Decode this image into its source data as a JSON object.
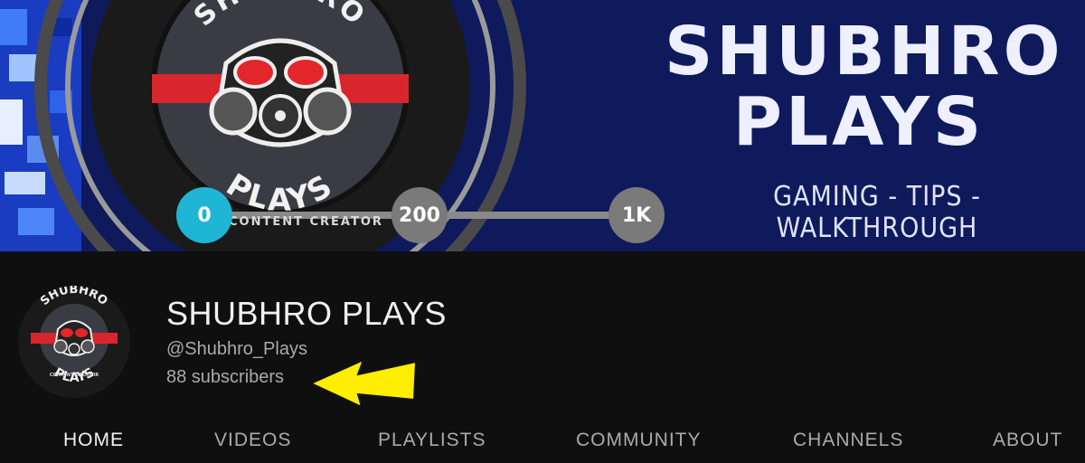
{
  "banner": {
    "logo_top_text": "SHUBHRO",
    "logo_bottom_text": "PLAYS",
    "creator_caption": "CONTENT CREATOR",
    "title_line1": "SHUBHRO",
    "title_line2": "PLAYS",
    "tagline": "GAMING - TIPS - WALKTHROUGH",
    "milestones": [
      "0",
      "200",
      "1K"
    ],
    "progress_fraction": 0.0,
    "colors": {
      "background": "#0f1a5c",
      "milestone_active": "#1fb5d4",
      "mask_red": "#d8262c"
    }
  },
  "channel": {
    "name": "SHUBHRO PLAYS",
    "handle": "@Shubhro_Plays",
    "subscribers": "88 subscribers",
    "avatar_top_text": "SHUBHRO",
    "avatar_bottom_text": "PLAYS",
    "avatar_caption": "CONTENT CREATOR"
  },
  "annotation": {
    "icon": "arrow-left-icon",
    "color": "#ffee00"
  },
  "tabs": [
    {
      "label": "HOME",
      "active": true
    },
    {
      "label": "VIDEOS",
      "active": false
    },
    {
      "label": "PLAYLISTS",
      "active": false
    },
    {
      "label": "COMMUNITY",
      "active": false
    },
    {
      "label": "CHANNELS",
      "active": false
    },
    {
      "label": "ABOUT",
      "active": false
    }
  ]
}
